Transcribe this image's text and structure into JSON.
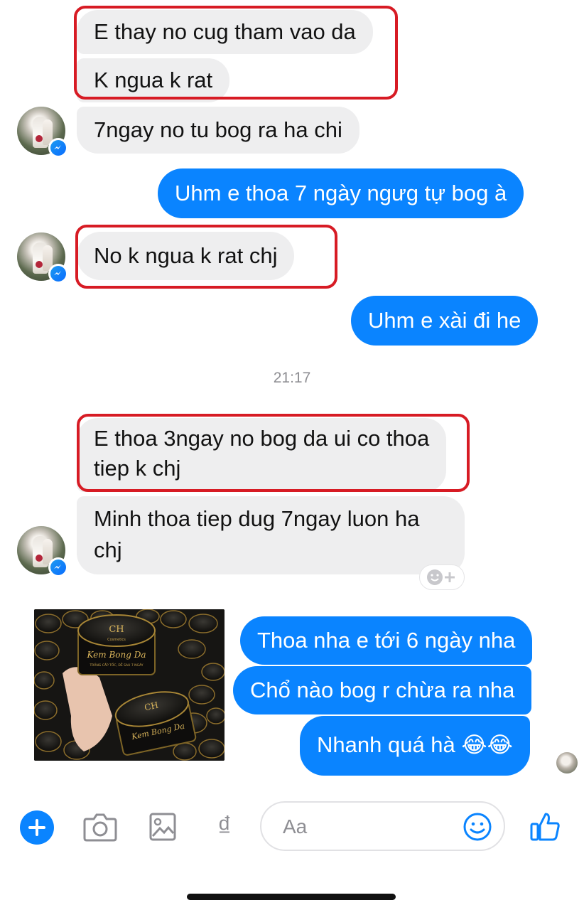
{
  "conversation": {
    "messages_top": [
      {
        "text": "E thay no cug tham vao da",
        "sender": "contact"
      },
      {
        "text": "K ngua k rat",
        "sender": "contact"
      },
      {
        "text": "7ngay no tu bog ra ha chi",
        "sender": "contact"
      },
      {
        "text": "Uhm e thoa 7 ngày ngưg tự bog à",
        "sender": "me"
      },
      {
        "text": "No k ngua k rat chj",
        "sender": "contact"
      },
      {
        "text": "Uhm e xài đi he",
        "sender": "me"
      }
    ],
    "timestamp": "21:17",
    "messages_bottom": [
      {
        "line1": "E thoa 3ngay no bog da ui co thoa",
        "line2": "tiep k chj",
        "sender": "contact"
      },
      {
        "line1": "Minh thoa tiep dug 7ngay luon ha",
        "line2": "chj",
        "sender": "contact"
      },
      {
        "text": "Thoa nha e tới 6 ngày nha",
        "sender": "me"
      },
      {
        "text": "Chổ nào bog r chừa ra nha",
        "sender": "me"
      },
      {
        "text": "Nhanh quá hà 😂😂",
        "sender": "me"
      }
    ],
    "photo": {
      "brand_mark": "CH",
      "brand_sub": "Cosmetics",
      "product_name": "Kem Bong Da",
      "product_tagline": "TRẮNG CẤP TỐC, DỄ SAU 7 NGÀY",
      "icon": "product-photo"
    },
    "reaction_button": {
      "icon": "smile-plus-icon"
    }
  },
  "composer": {
    "placeholder": "Aa",
    "icons": [
      "plus-icon",
      "camera-icon",
      "image-icon",
      "payment-dong-icon",
      "emoji-icon",
      "thumbs-up-icon"
    ],
    "currency_symbol": "₫"
  },
  "colors": {
    "outgoing": "#0a84ff",
    "incoming": "#eeeeef",
    "highlight_box": "#d71b24"
  }
}
